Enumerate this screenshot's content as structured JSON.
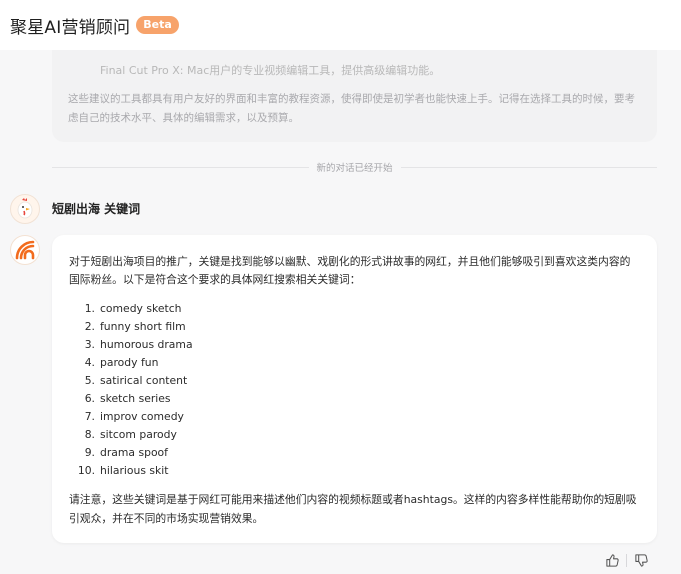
{
  "header": {
    "app_title": "聚星AI营销顾问",
    "beta_label": "Beta"
  },
  "previous_answer": {
    "faded_line": "Final Cut Pro X: Mac用户的专业视频编辑工具，提供高级编辑功能。",
    "closing_text": "这些建议的工具都具有用户友好的界面和丰富的教程资源，使得即使是初学者也能快速上手。记得在选择工具的时候，要考虑自己的技术水平、具体的编辑需求，以及预算。"
  },
  "divider_label": "新的对话已经开始",
  "user_message": "短剧出海 关键词",
  "ai_answer": {
    "intro": "对于短剧出海项目的推广，关键是找到能够以幽默、戏剧化的形式讲故事的网红，并且他们能够吸引到喜欢这类内容的国际粉丝。以下是符合这个要求的具体网红搜索相关关键词：",
    "keywords": [
      {
        "num": "1.",
        "text": "comedy sketch"
      },
      {
        "num": "2.",
        "text": "funny short film"
      },
      {
        "num": "3.",
        "text": "humorous drama"
      },
      {
        "num": "4.",
        "text": "parody fun"
      },
      {
        "num": "5.",
        "text": "satirical content"
      },
      {
        "num": "6.",
        "text": "sketch series"
      },
      {
        "num": "7.",
        "text": "improv comedy"
      },
      {
        "num": "8.",
        "text": "sitcom parody"
      },
      {
        "num": "9.",
        "text": "drama spoof"
      },
      {
        "num": "10.",
        "text": "hilarious skit"
      }
    ],
    "outro": "请注意，这些关键词是基于网红可能用来描述他们内容的视频标题或者hashtags。这样的内容多样性能帮助你的短剧吸引观众，并在不同的市场实现营销效果。"
  },
  "colors": {
    "accent": "#f7a36b",
    "ai_logo": "#f26b1d",
    "background": "#f7f7f8"
  },
  "icons": {
    "user_avatar": "rooster-avatar-icon",
    "ai_avatar": "ai-logo-icon",
    "like": "thumbs-up-icon",
    "dislike": "thumbs-down-icon"
  }
}
